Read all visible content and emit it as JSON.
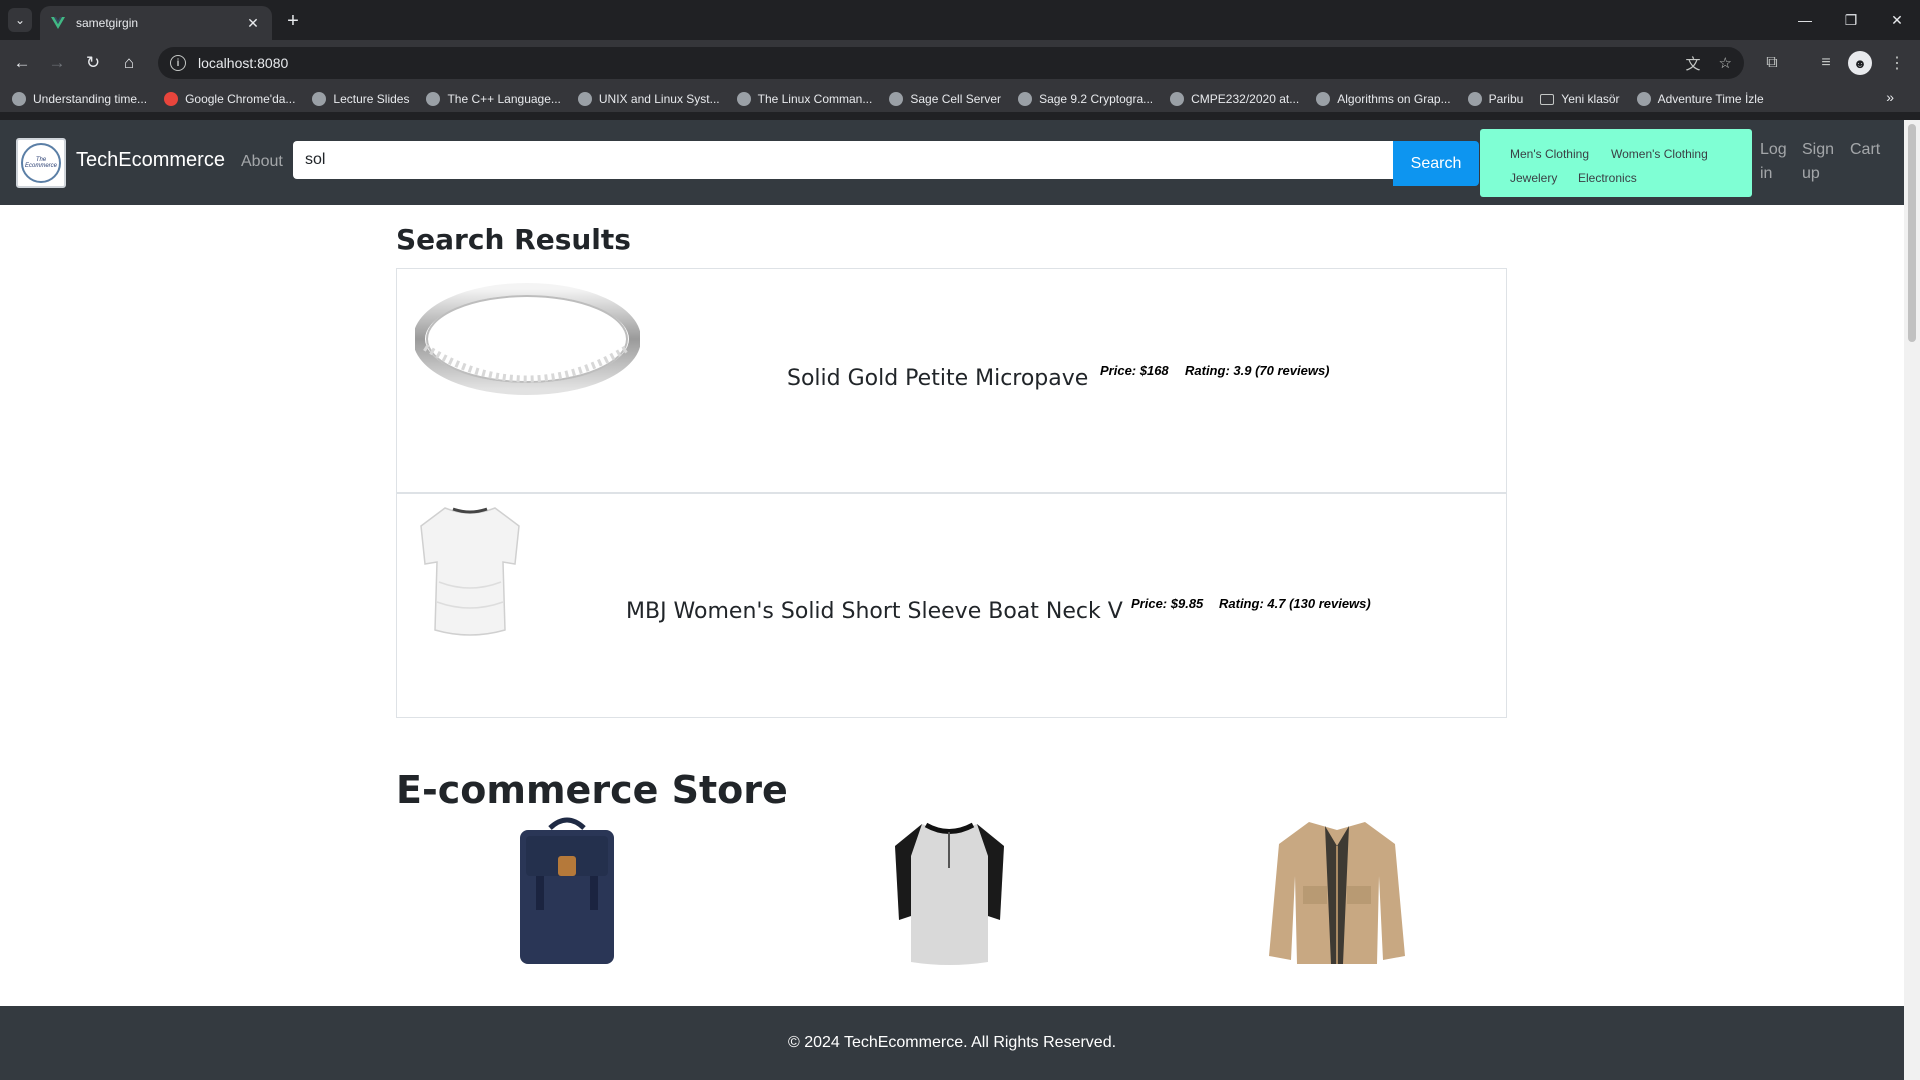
{
  "browser": {
    "tab_title": "sametgirgin",
    "url": "localhost:8080",
    "bookmarks": [
      "Understanding time...",
      "Google Chrome'da...",
      "Lecture Slides",
      "The C++ Language...",
      "UNIX and Linux Syst...",
      "The Linux Comman...",
      "Sage Cell Server",
      "Sage 9.2 Cryptogra...",
      "CMPE232/2020 at...",
      "Algorithms on Grap...",
      "Paribu",
      "Yeni klasör",
      "Adventure Time İzle"
    ]
  },
  "navbar": {
    "logo_text": "The Ecommerce",
    "brand": "TechEcommerce",
    "about": "About",
    "search_value": "sol",
    "search_button": "Search",
    "categories": [
      "Men's Clothing",
      "Women's Clothing",
      "Jewelery",
      "Electronics"
    ],
    "login_line1": "Log",
    "login_line2": "in",
    "signup_line1": "Sign",
    "signup_line2": "up",
    "cart": "Cart"
  },
  "search_results": {
    "title": "Search Results",
    "items": [
      {
        "name": "Solid Gold Petite Micropave",
        "price": "Price: $168",
        "rating": "Rating: 3.9 (70 reviews)"
      },
      {
        "name": "MBJ Women's Solid Short Sleeve Boat Neck V",
        "price": "Price: $9.85",
        "rating": "Rating: 4.7 (130 reviews)"
      }
    ]
  },
  "store": {
    "title": "E-commerce Store",
    "products": [
      "backpack",
      "henley-shirt",
      "jacket"
    ]
  },
  "footer": {
    "text": "© 2024 TechEcommerce. All Rights Reserved."
  }
}
